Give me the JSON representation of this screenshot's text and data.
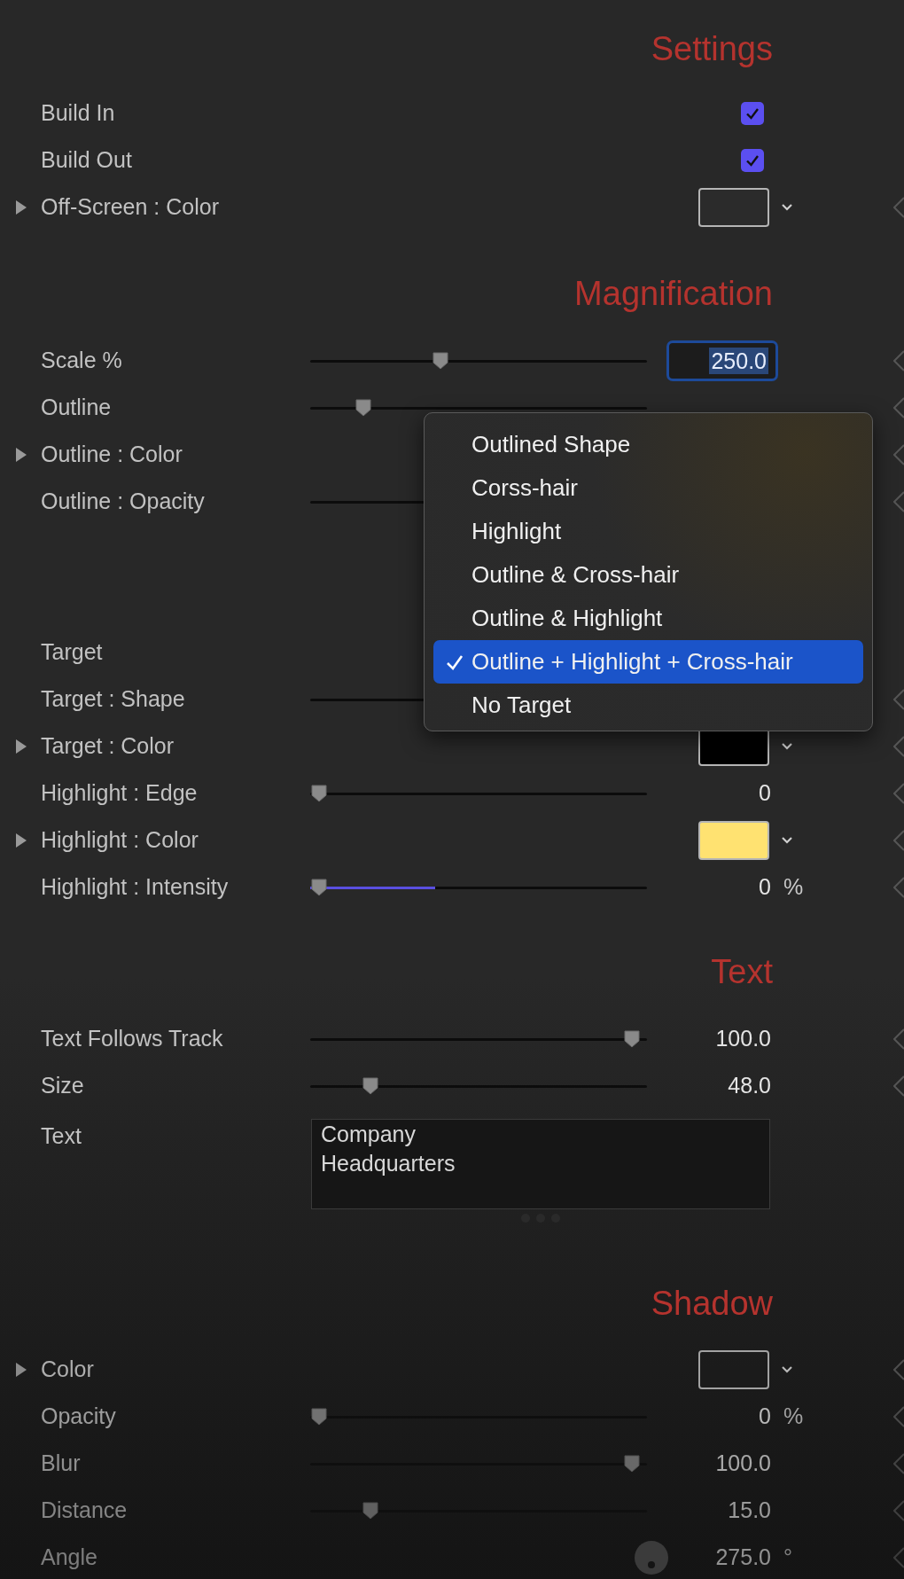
{
  "sections": [
    {
      "title": "Settings",
      "rows": [
        {
          "kind": "checkbox",
          "label": "Build In",
          "checked": true,
          "keyframe": false
        },
        {
          "kind": "checkbox",
          "label": "Build Out",
          "checked": true,
          "keyframe": false
        },
        {
          "kind": "color",
          "label": "Off-Screen : Color",
          "color": "#2b2b2b",
          "keyframe": true
        }
      ]
    },
    {
      "title": "Magnification",
      "rows": [
        {
          "kind": "field",
          "label": "Scale %",
          "level": 0.38,
          "value": "250.0",
          "keyframe": true
        },
        {
          "kind": "slider",
          "label": "Outline",
          "level": 0.14,
          "keyframe": true
        },
        {
          "kind": "color",
          "label": "Outline : Color",
          "keyframe": true
        },
        {
          "kind": "slider",
          "label": "Outline : Opacity",
          "keyframe": true
        },
        {
          "kind": "popup",
          "label": "Target",
          "keyframe": false
        },
        {
          "kind": "slider",
          "label": "Target : Shape",
          "keyframe": true
        },
        {
          "kind": "color",
          "label": "Target : Color",
          "color": "#000000",
          "keyframe": true
        },
        {
          "kind": "slider",
          "label": "Highlight : Edge",
          "level": 0,
          "value": "0",
          "keyframe": true
        },
        {
          "kind": "color",
          "label": "Highlight : Color",
          "color": "#ffe271",
          "keyframe": true
        },
        {
          "kind": "slider",
          "label": "Highlight : Intensity",
          "level": 0,
          "fill": {
            "level": 0.37
          },
          "value": "0",
          "unit": "%",
          "keyframe": true
        }
      ]
    },
    {
      "title": "Text",
      "rows": [
        {
          "kind": "slider",
          "label": "Text Follows Track",
          "level": 0.98,
          "value": "100.0",
          "keyframe": true
        },
        {
          "kind": "slider",
          "label": "Size",
          "level": 0.16,
          "value": "48.0",
          "keyframe": true
        },
        {
          "kind": "text",
          "label": "Text",
          "value": "Company\nHeadquarters",
          "keyframe": false
        }
      ]
    },
    {
      "title": "Shadow",
      "rows": [
        {
          "kind": "color",
          "label": "Color",
          "color": "#1c1c1c",
          "keyframe": true
        },
        {
          "kind": "slider",
          "label": "Opacity",
          "level": 0,
          "value": "0",
          "unit": "%",
          "keyframe": true
        },
        {
          "kind": "slider",
          "label": "Blur",
          "level": 0.98,
          "value": "100.0",
          "keyframe": true
        },
        {
          "kind": "slider",
          "label": "Distance",
          "level": 0.16,
          "value": "15.0",
          "keyframe": true
        },
        {
          "kind": "angle",
          "label": "Angle",
          "value": "275.0",
          "unit": "°",
          "keyframe": true
        }
      ]
    }
  ],
  "menu": {
    "items": [
      {
        "label": "Outlined Shape",
        "selected": false
      },
      {
        "label": "Corss-hair",
        "selected": false
      },
      {
        "label": "Highlight",
        "selected": false
      },
      {
        "label": "Outline & Cross-hair",
        "selected": false
      },
      {
        "label": "Outline & Highlight",
        "selected": false
      },
      {
        "label": "Outline + Highlight + Cross-hair",
        "selected": true
      },
      {
        "label": "No Target",
        "selected": false
      }
    ]
  }
}
